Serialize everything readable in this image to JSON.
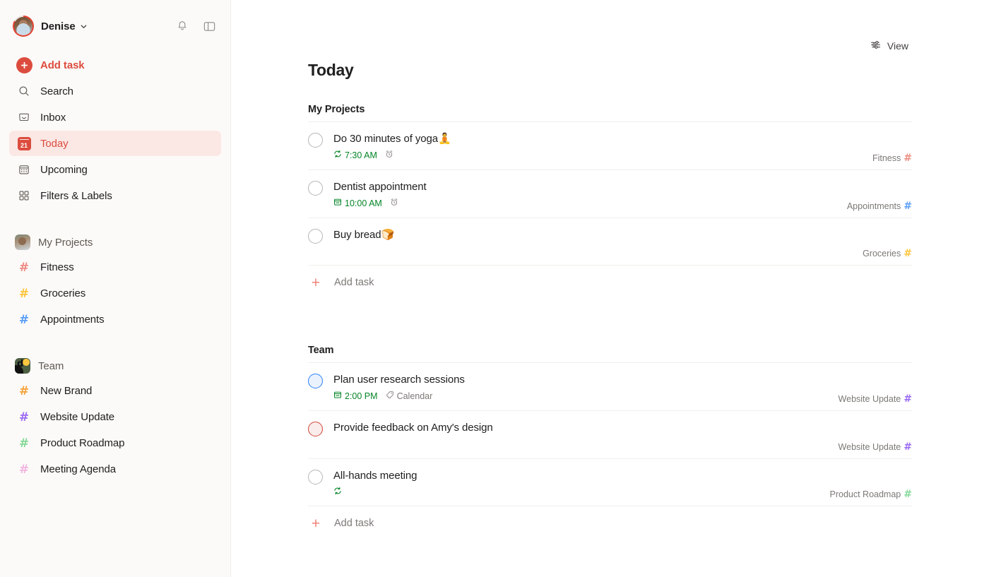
{
  "sidebar": {
    "user": {
      "name": "Denise",
      "avatar_icon": "user-avatar-photo",
      "chevron_icon": "chevron-down-icon"
    },
    "top_actions": [
      {
        "name": "notifications",
        "icon": "bell-icon"
      },
      {
        "name": "toggle-sidebar",
        "icon": "panel-layout-icon"
      }
    ],
    "nav": [
      {
        "label": "Add task",
        "icon": "plus-circle-icon",
        "active": false,
        "accent": true
      },
      {
        "label": "Search",
        "icon": "search-icon",
        "active": false
      },
      {
        "label": "Inbox",
        "icon": "inbox-icon",
        "active": false
      },
      {
        "label": "Today",
        "icon": "calendar-today-icon",
        "active": true
      },
      {
        "label": "Upcoming",
        "icon": "calendar-grid-icon",
        "active": false
      },
      {
        "label": "Filters & Labels",
        "icon": "filters-labels-icon",
        "active": false
      }
    ],
    "workspaces": [
      {
        "label": "My Projects",
        "icon": "my-projects-avatar-icon",
        "projects": [
          {
            "label": "Fitness",
            "color": "#ed8c82"
          },
          {
            "label": "Groceries",
            "color": "#ffc53d"
          },
          {
            "label": "Appointments",
            "color": "#5b9ef7"
          }
        ]
      },
      {
        "label": "Team",
        "icon": "team-workspace-icon",
        "projects": [
          {
            "label": "New Brand",
            "color": "#f5a33c"
          },
          {
            "label": "Website Update",
            "color": "#9b6bf2"
          },
          {
            "label": "Product Roadmap",
            "color": "#86d99a"
          },
          {
            "label": "Meeting Agenda",
            "color": "#f2b5e0"
          }
        ]
      }
    ]
  },
  "main": {
    "view_button": {
      "label": "View",
      "icon": "sliders-icon"
    },
    "page_title": "Today",
    "groups": [
      {
        "title": "My Projects",
        "add_task_label": "Add task",
        "tasks": [
          {
            "title": "Do 30 minutes of yoga",
            "emoji": "🧘",
            "priority": "p4",
            "date_icon": "recurring-icon",
            "date_text": "7:30 AM",
            "extra_icon": "alarm-clock-icon",
            "extra_text": "",
            "project": "Fitness",
            "project_color": "#ed8c82"
          },
          {
            "title": "Dentist appointment",
            "emoji": "",
            "priority": "p4",
            "date_icon": "calendar-icon",
            "date_text": "10:00 AM",
            "extra_icon": "alarm-clock-icon",
            "extra_text": "",
            "project": "Appointments",
            "project_color": "#5b9ef7"
          },
          {
            "title": "Buy bread",
            "emoji": "🍞",
            "priority": "p4",
            "date_icon": "",
            "date_text": "",
            "extra_icon": "",
            "extra_text": "",
            "project": "Groceries",
            "project_color": "#ffc53d"
          }
        ]
      },
      {
        "title": "Team",
        "add_task_label": "Add task",
        "tasks": [
          {
            "title": "Plan user research sessions",
            "emoji": "",
            "priority": "p2",
            "date_icon": "calendar-icon",
            "date_text": "2:00 PM",
            "extra_icon": "label-tag-icon",
            "extra_text": "Calendar",
            "project": "Website Update",
            "project_color": "#9b6bf2"
          },
          {
            "title": "Provide feedback on Amy's design",
            "emoji": "",
            "priority": "p1",
            "date_icon": "",
            "date_text": "",
            "extra_icon": "",
            "extra_text": "",
            "project": "Website Update",
            "project_color": "#9b6bf2"
          },
          {
            "title": "All-hands meeting",
            "emoji": "",
            "priority": "p4",
            "date_icon": "recurring-icon",
            "date_text": "",
            "extra_icon": "",
            "extra_text": "",
            "project": "Product Roadmap",
            "project_color": "#86d99a"
          }
        ]
      }
    ]
  }
}
